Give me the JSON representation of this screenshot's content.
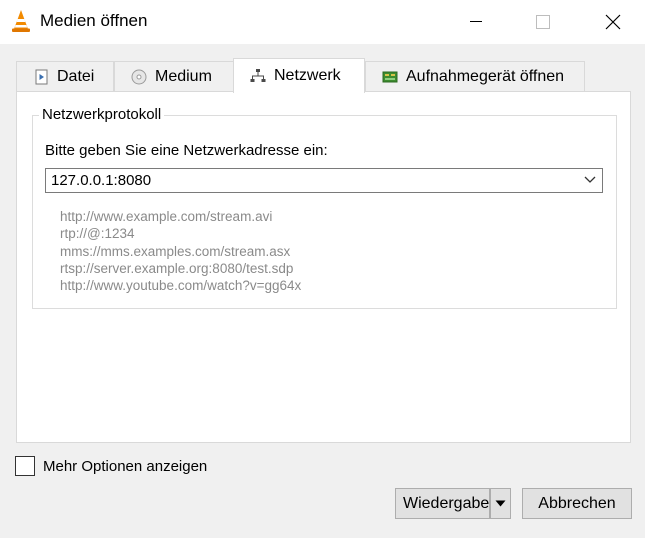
{
  "window": {
    "title": "Medien öffnen",
    "controls": [
      "minimize",
      "maximize",
      "close"
    ]
  },
  "tabs": [
    {
      "label": "Datei",
      "icon": "file-play-icon",
      "active": false
    },
    {
      "label": "Medium",
      "icon": "disc-icon",
      "active": false
    },
    {
      "label": "Netzwerk",
      "icon": "network-icon",
      "active": true
    },
    {
      "label": "Aufnahmegerät öffnen",
      "icon": "capture-card-icon",
      "active": false
    }
  ],
  "network": {
    "group_title": "Netzwerkprotokoll",
    "prompt": "Bitte geben Sie eine Netzwerkadresse ein:",
    "address_value": "127.0.0.1:8080",
    "examples": [
      "http://www.example.com/stream.avi",
      "rtp://@:1234",
      "mms://mms.examples.com/stream.asx",
      "rtsp://server.example.org:8080/test.sdp",
      "http://www.youtube.com/watch?v=gg64x"
    ]
  },
  "options": {
    "more_options_label": "Mehr Optionen anzeigen",
    "more_options_checked": false
  },
  "buttons": {
    "play_label": "Wiedergabe",
    "cancel_label": "Abbrechen"
  },
  "colors": {
    "vlc_orange": "#f28a00",
    "hint_text": "#8a8a8a",
    "panel_bg": "#ffffff",
    "window_bg": "#f0f0f0"
  }
}
